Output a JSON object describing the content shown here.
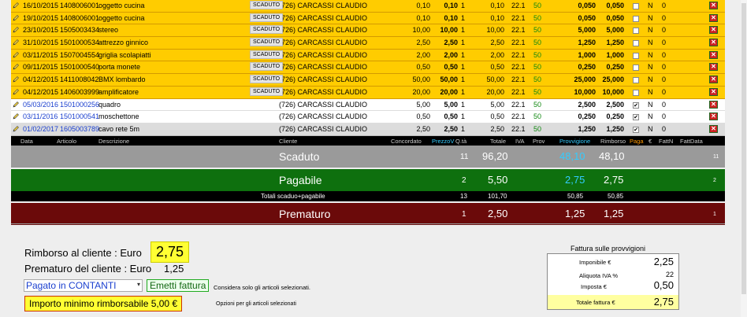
{
  "rows": [
    {
      "style": "y",
      "date": "16/10/2015",
      "code": "1408006001",
      "desc": "oggetto cucina",
      "state": "SCADUTO",
      "client": "(726) CARCASSI CLAUDIO",
      "conc": "0,10",
      "prezzov": "0,10",
      "qta": "1",
      "totale": "0,10",
      "iva": "22.1",
      "prov": "50",
      "provv": "0,050",
      "rimb": "0,050",
      "checked": false,
      "n": "N",
      "faz": "0"
    },
    {
      "style": "y",
      "date": "19/10/2015",
      "code": "1408006001",
      "desc": "oggetto cucina",
      "state": "SCADUTO",
      "client": "(726) CARCASSI CLAUDIO",
      "conc": "0,10",
      "prezzov": "0,10",
      "qta": "1",
      "totale": "0,10",
      "iva": "22.1",
      "prov": "50",
      "provv": "0,050",
      "rimb": "0,050",
      "checked": false,
      "n": "N",
      "faz": "0"
    },
    {
      "style": "y",
      "date": "23/10/2015",
      "code": "1505003434",
      "desc": "stereo",
      "state": "SCADUTO",
      "client": "(726) CARCASSI CLAUDIO",
      "conc": "10,00",
      "prezzov": "10,00",
      "qta": "1",
      "totale": "10,00",
      "iva": "22.1",
      "prov": "50",
      "provv": "5,000",
      "rimb": "5,000",
      "checked": false,
      "n": "N",
      "faz": "0"
    },
    {
      "style": "y",
      "date": "31/10/2015",
      "code": "1501000534",
      "desc": "attrezzo ginnico",
      "state": "SCADUTO",
      "client": "(726) CARCASSI CLAUDIO",
      "conc": "2,50",
      "prezzov": "2,50",
      "qta": "1",
      "totale": "2,50",
      "iva": "22.1",
      "prov": "50",
      "provv": "1,250",
      "rimb": "1,250",
      "checked": false,
      "n": "N",
      "faz": "0"
    },
    {
      "style": "y",
      "date": "03/11/2015",
      "code": "1507004554",
      "desc": "griglia scolapiatti",
      "state": "SCADUTO",
      "client": "(726) CARCASSI CLAUDIO",
      "conc": "2,00",
      "prezzov": "2,00",
      "qta": "1",
      "totale": "2,00",
      "iva": "22.1",
      "prov": "50",
      "provv": "1,000",
      "rimb": "1,000",
      "checked": false,
      "n": "N",
      "faz": "0"
    },
    {
      "style": "y",
      "date": "09/11/2015",
      "code": "1501000540",
      "desc": "porta monete",
      "state": "SCADUTO",
      "client": "(726) CARCASSI CLAUDIO",
      "conc": "0,50",
      "prezzov": "0,50",
      "qta": "1",
      "totale": "0,50",
      "iva": "22.1",
      "prov": "50",
      "provv": "0,250",
      "rimb": "0,250",
      "checked": false,
      "n": "N",
      "faz": "0"
    },
    {
      "style": "y",
      "date": "04/12/2015",
      "code": "1411008042",
      "desc": "BMX lombardo",
      "state": "SCADUTO",
      "client": "(726) CARCASSI CLAUDIO",
      "conc": "50,00",
      "prezzov": "50,00",
      "qta": "1",
      "totale": "50,00",
      "iva": "22.1",
      "prov": "50",
      "provv": "25,000",
      "rimb": "25,000",
      "checked": false,
      "n": "N",
      "faz": "0"
    },
    {
      "style": "y",
      "date": "04/12/2015",
      "code": "1406003999",
      "desc": "amplificatore",
      "state": "SCADUTO",
      "client": "(726) CARCASSI CLAUDIO",
      "conc": "20,00",
      "prezzov": "20,00",
      "qta": "1",
      "totale": "20,00",
      "iva": "22.1",
      "prov": "50",
      "provv": "10,000",
      "rimb": "10,000",
      "checked": false,
      "n": "N",
      "faz": "0"
    },
    {
      "style": "w",
      "date": "05/03/2016",
      "code": "1501000256",
      "desc": "quadro",
      "state": "",
      "client": "(726) CARCASSI CLAUDIO",
      "conc": "5,00",
      "prezzov": "5,00",
      "qta": "1",
      "totale": "5,00",
      "iva": "22.1",
      "prov": "50",
      "provv": "2,500",
      "rimb": "2,500",
      "checked": true,
      "n": "N",
      "faz": "0"
    },
    {
      "style": "w",
      "date": "03/11/2016",
      "code": "1501000541",
      "desc": "moschettone",
      "state": "",
      "client": "(726) CARCASSI CLAUDIO",
      "conc": "0,50",
      "prezzov": "0,50",
      "qta": "1",
      "totale": "0,50",
      "iva": "22.1",
      "prov": "50",
      "provv": "0,250",
      "rimb": "0,250",
      "checked": true,
      "n": "N",
      "faz": "0"
    },
    {
      "style": "g",
      "date": "01/02/2017",
      "code": "1605003789",
      "desc": "cavo rete 5m",
      "state": "",
      "client": "(726) CARCASSI CLAUDIO",
      "conc": "2,50",
      "prezzov": "2,50",
      "qta": "1",
      "totale": "2,50",
      "iva": "22.1",
      "prov": "50",
      "provv": "1,250",
      "rimb": "1,250",
      "checked": true,
      "n": "N",
      "faz": "0"
    }
  ],
  "header": {
    "data": "Data",
    "articolo": "Articolo",
    "descrizione": "Descrizione",
    "cliente": "Cliente",
    "concordato": "Concordato",
    "prezzov": "PrezzoV",
    "qta": "Q.tà",
    "totale": "Totale",
    "iva": "IVA",
    "prov": "Prov",
    "provvigione": "Provvigione",
    "rimborso": "Rimborso",
    "paga": "Paga",
    "euro": "€",
    "fattn": "FattN",
    "fattdata": "FattData"
  },
  "summary": {
    "scaduto": {
      "label": "Scaduto",
      "count": "11",
      "totale": "96,20",
      "provv": "48,10",
      "rimb": "48,10",
      "extra": "11"
    },
    "pagabile": {
      "label": "Pagabile",
      "count": "2",
      "totale": "5,50",
      "provv": "2,75",
      "rimb": "2,75",
      "extra": "2"
    },
    "totali": {
      "label": "Totali scaduo+pagabile",
      "count": "13",
      "totale": "101,70",
      "provv": "50,85",
      "rimb": "50,85"
    },
    "prematuro": {
      "label": "Prematuro",
      "count": "1",
      "totale": "2,50",
      "provv": "1,25",
      "rimb": "1,25",
      "extra": "1"
    }
  },
  "bottom": {
    "rimborso_label": "Rimborso al cliente : Euro",
    "rimborso_value": "2,75",
    "prematuro_label": "Prematuro del cliente : Euro",
    "prematuro_value": "1,25",
    "pagato_select": "Pagato in CONTANTI",
    "emetti_button": "Emetti fattura",
    "considera_note": "Considera solo gli articoli selezionati.",
    "importo_button": "Importo minimo rimborsabile 5,00 €",
    "opzioni_note": "Opzioni per gli articoli selezionati"
  },
  "fattura": {
    "title": "Fattura sulle provvigioni",
    "imponibile_label": "Imponibile €",
    "imponibile_value": "2,25",
    "aliquota_label": "Aliquota IVA %",
    "aliquota_value": "22",
    "imposta_label": "Imposta €",
    "imposta_value": "0,50",
    "totale_label": "Totale fattura €",
    "totale_value": "2,75"
  },
  "colors": {
    "scaduto_row": "#ffcc00",
    "scaduto_band": "#9a9a9a",
    "pagabile_band": "#0e700e",
    "prematuro_band": "#6b0a0a",
    "provv_cyan": "#33ccff",
    "highlight": "#ffff33"
  },
  "icons": {
    "edit": "pencil-icon",
    "delete": "delete-x-icon"
  }
}
